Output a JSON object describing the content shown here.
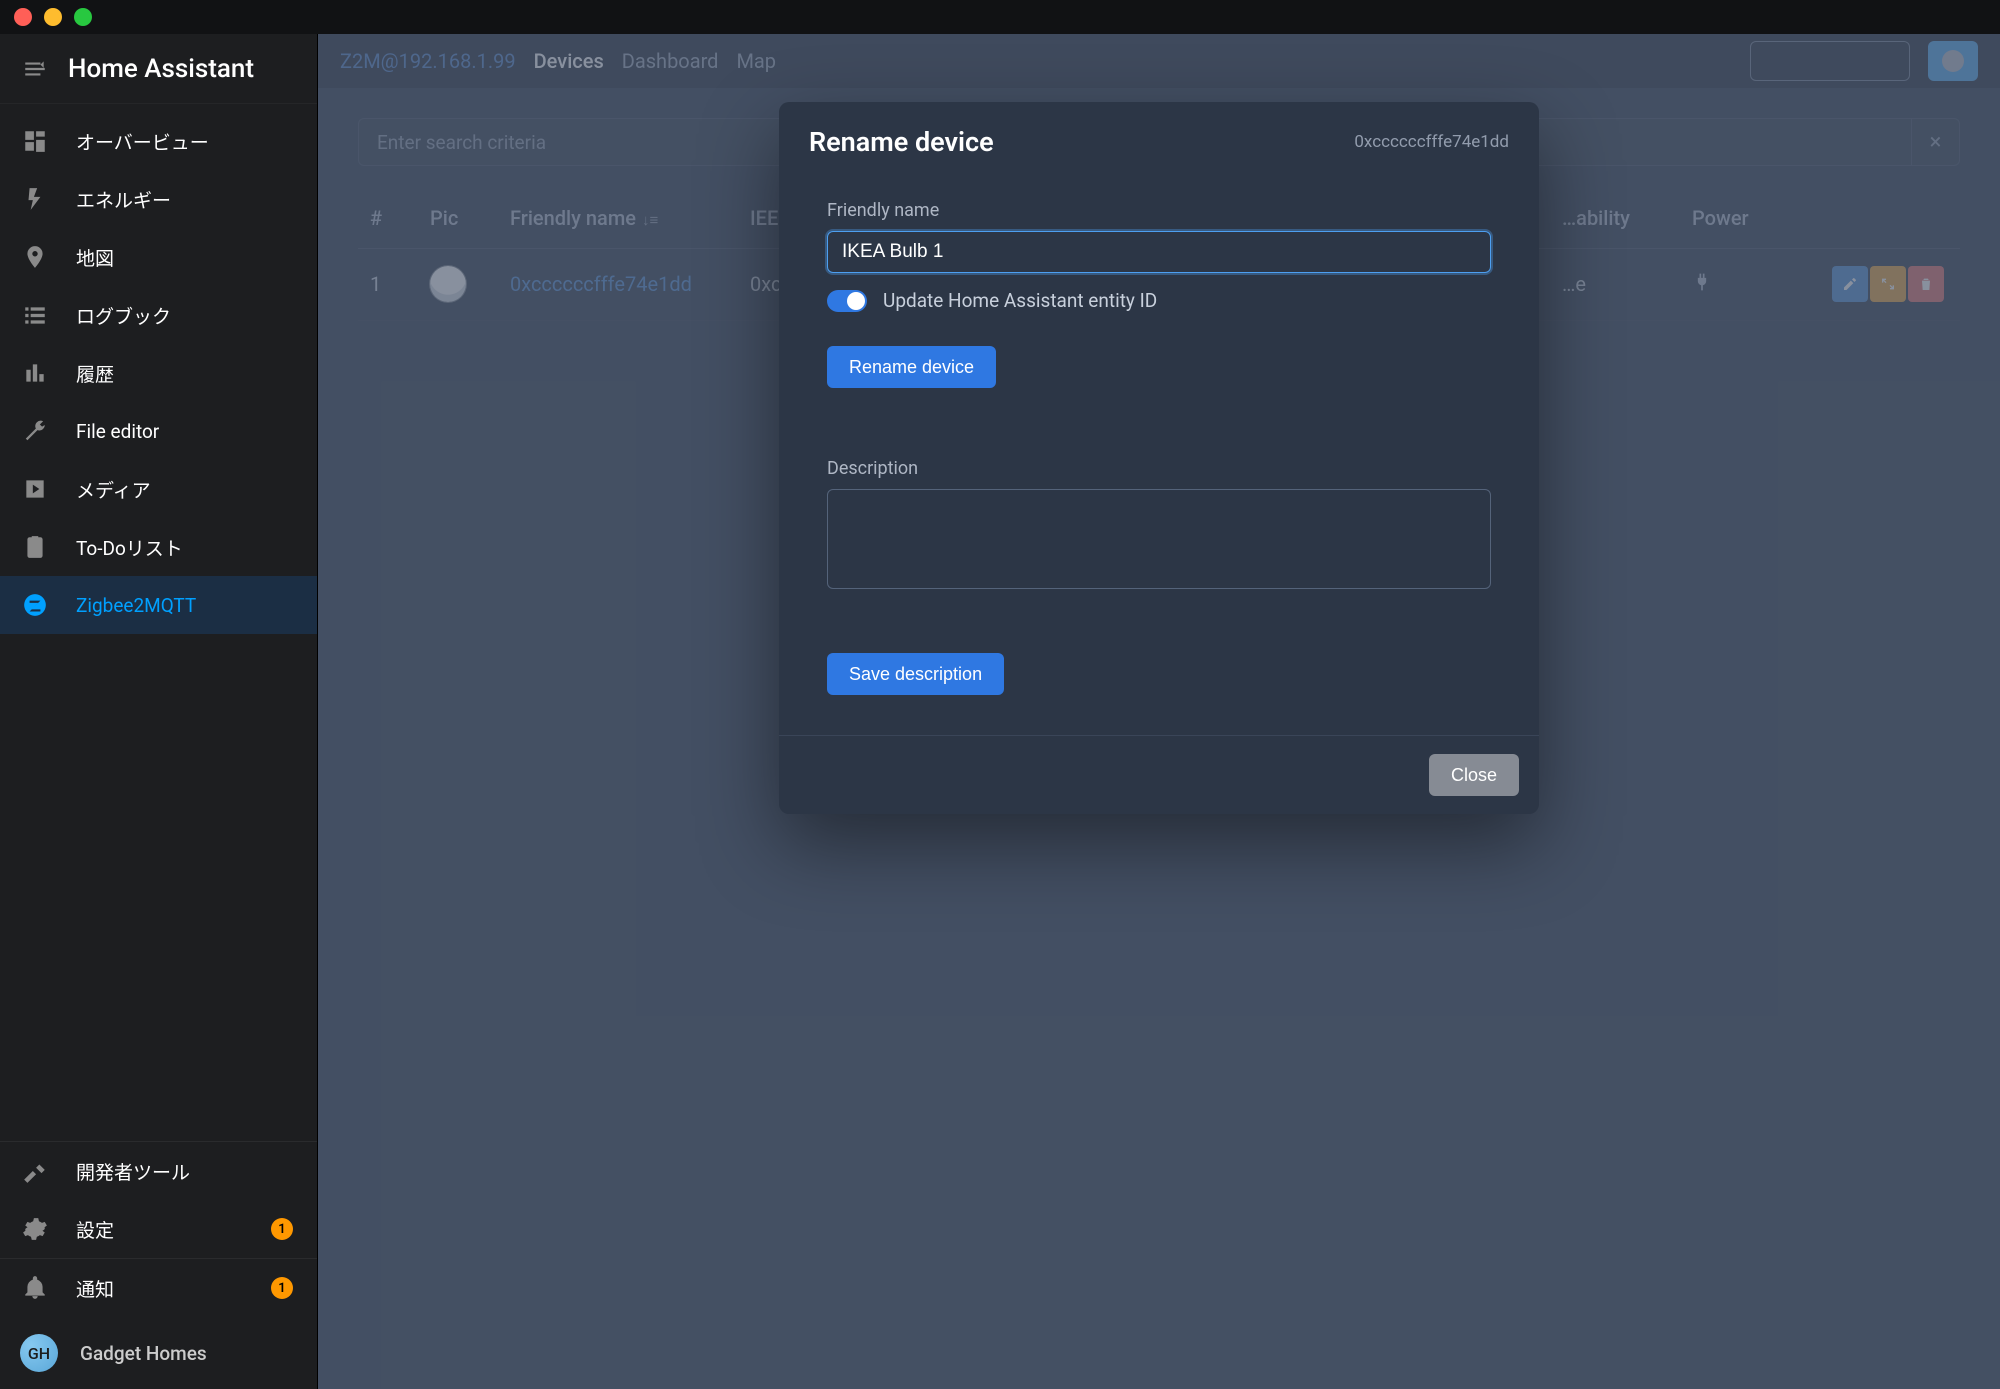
{
  "app_title": "Home Assistant",
  "sidebar": {
    "items": [
      {
        "label": "オーバービュー",
        "name": "overview"
      },
      {
        "label": "エネルギー",
        "name": "energy"
      },
      {
        "label": "地図",
        "name": "map"
      },
      {
        "label": "ログブック",
        "name": "logbook"
      },
      {
        "label": "履歴",
        "name": "history"
      },
      {
        "label": "File editor",
        "name": "file-editor"
      },
      {
        "label": "メディア",
        "name": "media"
      },
      {
        "label": "To-Doリスト",
        "name": "todo"
      },
      {
        "label": "Zigbee2MQTT",
        "name": "z2m",
        "active": true
      }
    ],
    "bottom": [
      {
        "label": "開発者ツール",
        "name": "devtools"
      },
      {
        "label": "設定",
        "name": "settings",
        "badge": "1"
      }
    ],
    "notify": {
      "label": "通知",
      "badge": "1"
    },
    "user": {
      "initials": "GH",
      "name": "Gadget Homes"
    }
  },
  "topnav": {
    "brand": "Z2M@192.168.1.99",
    "tabs": [
      {
        "label": "Devices",
        "active": true
      },
      {
        "label": "Dashboard"
      },
      {
        "label": "Map"
      }
    ]
  },
  "search_placeholder": "Enter search criteria",
  "table": {
    "cols": {
      "num": "#",
      "pic": "Pic",
      "fname": "Friendly name",
      "ieee": "IEE",
      "avail": "…ability",
      "power": "Power"
    },
    "rows": [
      {
        "num": "1",
        "fname": "0xccccccfffe74e1dd",
        "ieee": "0xc… (0x…"
      }
    ]
  },
  "modal": {
    "title": "Rename device",
    "device_id": "0xccccccfffe74e1dd",
    "friendly_label": "Friendly name",
    "friendly_value": "IKEA Bulb 1",
    "update_ha": "Update Home Assistant entity ID",
    "rename_btn": "Rename device",
    "desc_label": "Description",
    "save_desc_btn": "Save description",
    "close_btn": "Close"
  }
}
